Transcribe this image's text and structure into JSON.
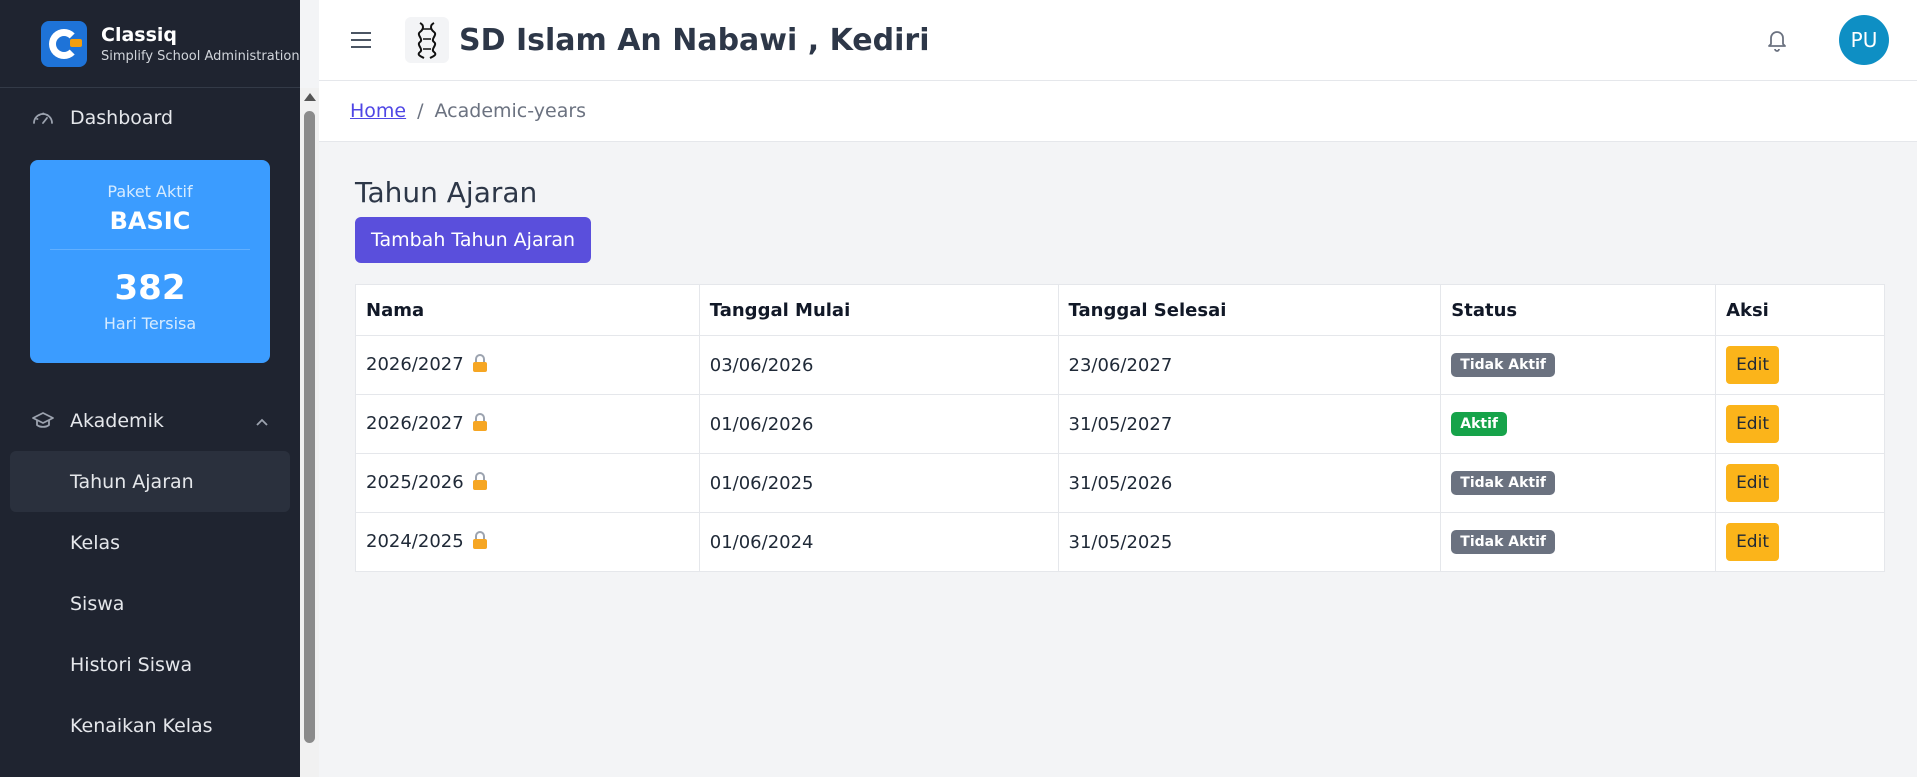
{
  "brand": {
    "name": "Classiq",
    "tagline": "Simplify School Administration"
  },
  "sidebar": {
    "dashboard_label": "Dashboard",
    "plan": {
      "label": "Paket Aktif",
      "name": "BASIC",
      "days": "382",
      "days_label": "Hari Tersisa"
    },
    "section_label": "Akademik",
    "items": [
      "Tahun Ajaran",
      "Kelas",
      "Siswa",
      "Histori Siswa",
      "Kenaikan Kelas"
    ]
  },
  "header": {
    "school_name": "SD Islam An Nabawi , Kediri",
    "avatar_initials": "PU"
  },
  "breadcrumb": {
    "home": "Home",
    "separator": "/",
    "current": "Academic-years"
  },
  "page": {
    "title": "Tahun Ajaran",
    "add_button": "Tambah Tahun Ajaran"
  },
  "table": {
    "headers": [
      "Nama",
      "Tanggal Mulai",
      "Tanggal Selesai",
      "Status",
      "Aksi"
    ],
    "rows": [
      {
        "name": "2026/2027",
        "start": "03/06/2026",
        "end": "23/06/2027",
        "status": "Tidak Aktif",
        "action": "Edit"
      },
      {
        "name": "2026/2027",
        "start": "01/06/2026",
        "end": "31/05/2027",
        "status": "Aktif",
        "action": "Edit"
      },
      {
        "name": "2025/2026",
        "start": "01/06/2025",
        "end": "31/05/2026",
        "status": "Tidak Aktif",
        "action": "Edit"
      },
      {
        "name": "2024/2025",
        "start": "01/06/2024",
        "end": "31/05/2025",
        "status": "Tidak Aktif",
        "action": "Edit"
      }
    ]
  },
  "colors": {
    "sidebar_bg": "#1f2430",
    "plan_card": "#3b9cff",
    "primary_button": "#5a4fdc",
    "badge_inactive": "#6b7280",
    "badge_active": "#16a34a",
    "edit_button": "#fbb41a",
    "avatar": "#0e8fc4"
  }
}
